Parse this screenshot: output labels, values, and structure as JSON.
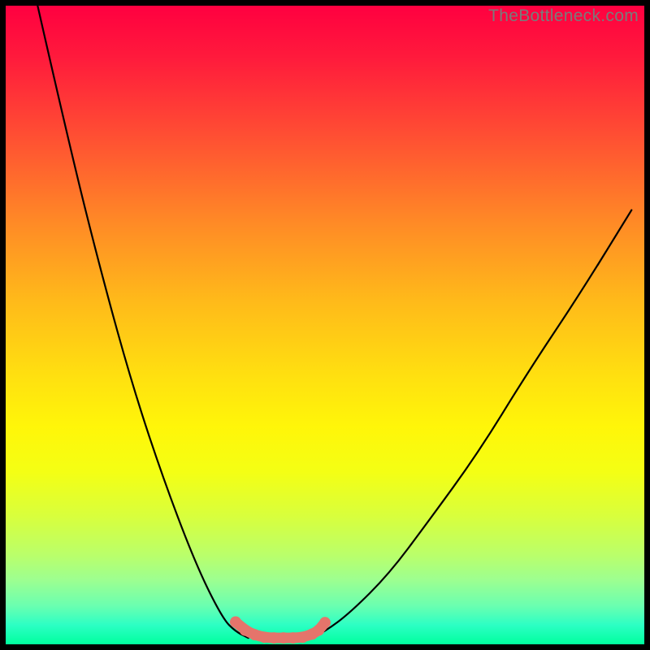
{
  "watermark": "TheBottleneck.com",
  "chart_data": {
    "type": "line",
    "title": "",
    "xlabel": "",
    "ylabel": "",
    "xlim": [
      0,
      100
    ],
    "ylim": [
      0,
      100
    ],
    "grid": false,
    "series": [
      {
        "name": "left-curve",
        "color": "#000000",
        "x": [
          5,
          10,
          15,
          20,
          25,
          30,
          34,
          36,
          38
        ],
        "y": [
          100,
          78,
          58,
          40,
          25,
          12,
          4,
          2,
          1
        ]
      },
      {
        "name": "right-curve",
        "color": "#000000",
        "x": [
          48,
          50,
          54,
          60,
          66,
          74,
          82,
          90,
          98
        ],
        "y": [
          1,
          2,
          5,
          11,
          19,
          30,
          43,
          55,
          68
        ]
      },
      {
        "name": "bottom-marker",
        "color": "#e5746b",
        "x": [
          36,
          37.5,
          39,
          40.5,
          42,
          43.5,
          45,
          46.5,
          48,
          49,
          50
        ],
        "y": [
          3.5,
          2.2,
          1.5,
          1.1,
          1,
          1,
          1,
          1.1,
          1.6,
          2.2,
          3.4
        ]
      }
    ]
  }
}
